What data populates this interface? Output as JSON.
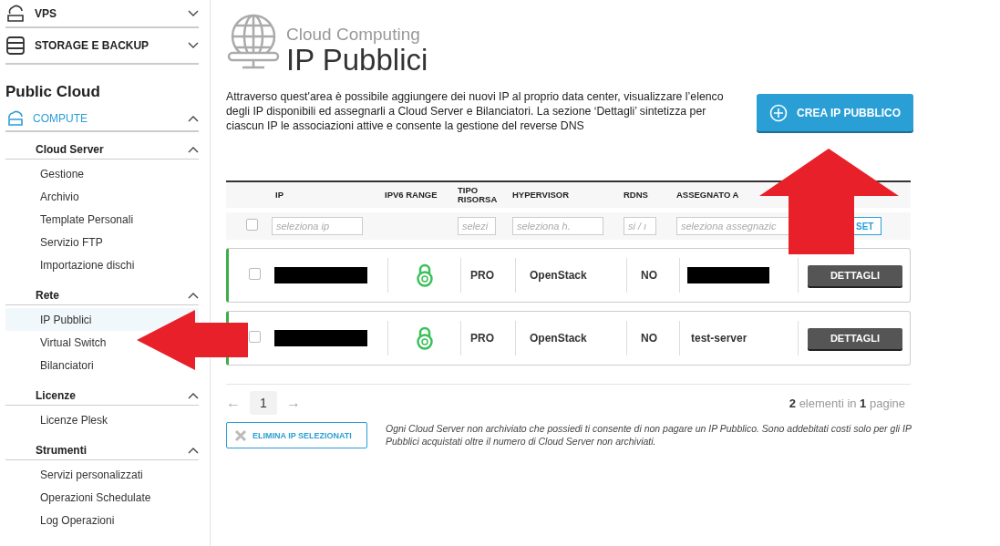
{
  "sidebar": {
    "products": [
      {
        "label": "VPS",
        "expanded": false,
        "kind": "cloud"
      },
      {
        "label": "STORAGE E BACKUP",
        "expanded": false,
        "kind": "storage"
      }
    ],
    "heading": "Public Cloud",
    "category": {
      "label": "COMPUTE",
      "expanded": true,
      "groups": [
        {
          "label": "Cloud Server",
          "expanded": true,
          "items": [
            {
              "label": "Gestione",
              "selected": false
            },
            {
              "label": "Archivio",
              "selected": false
            },
            {
              "label": "Template Personali",
              "selected": false
            },
            {
              "label": "Servizio FTP",
              "selected": false
            },
            {
              "label": "Importazione dischi",
              "selected": false
            }
          ]
        },
        {
          "label": "Rete",
          "expanded": true,
          "items": [
            {
              "label": "IP Pubblici",
              "selected": true
            },
            {
              "label": "Virtual Switch",
              "selected": false
            },
            {
              "label": "Bilanciatori",
              "selected": false
            }
          ]
        },
        {
          "label": "Licenze",
          "expanded": true,
          "items": [
            {
              "label": "Licenze Plesk",
              "selected": false
            }
          ]
        },
        {
          "label": "Strumenti",
          "expanded": true,
          "items": [
            {
              "label": "Servizi personalizzati",
              "selected": false
            },
            {
              "label": "Operazioni Schedulate",
              "selected": false
            },
            {
              "label": "Log Operazioni",
              "selected": false
            }
          ]
        }
      ]
    }
  },
  "header": {
    "subtitle": "Cloud Computing",
    "title": "IP Pubblici"
  },
  "description": "Attraverso quest'area è possibile aggiungere dei nuovi IP al proprio data center, visualizzare l’elenco degli IP disponibili ed assegnarli a Cloud Server e Bilanciatori. La sezione ‘Dettagli’ sintetizza per ciascun IP le associazioni attive e consente la gestione del reverse DNS",
  "create_button": "CREA IP PUBBLICO",
  "table": {
    "columns": [
      "IP",
      "IPV6 RANGE",
      "TIPO RISORSA",
      "HYPERVISOR",
      "RDNS",
      "ASSEGNATO A"
    ],
    "filters": {
      "checked": false,
      "ip": {
        "placeholder": "seleziona ip"
      },
      "tipo": {
        "placeholder": "selezi"
      },
      "hypervisor": {
        "placeholder": "seleziona h."
      },
      "rdns": {
        "placeholder": "si / ı"
      },
      "assigned": {
        "placeholder": "seleziona assegnazic"
      },
      "reset": "SET"
    },
    "rows": [
      {
        "checked": false,
        "active": true,
        "ip_redacted": true,
        "tipo": "PRO",
        "hypervisor": "OpenStack",
        "rdns": "NO",
        "assigned_redacted": true,
        "action": "DETTAGLI"
      },
      {
        "checked": false,
        "active": true,
        "ip_redacted": true,
        "tipo": "PRO",
        "hypervisor": "OpenStack",
        "rdns": "NO",
        "assigned_redacted": false,
        "assigned": "test-server",
        "action": "DETTAGLI"
      }
    ]
  },
  "pagination": {
    "prev": "←",
    "next": "→",
    "pages": [
      {
        "label": "1",
        "selected": true
      }
    ],
    "summary": "**2** elementi in **1** pagine"
  },
  "delete_button": "ELIMINA IP SELEZIONATI",
  "note": "Ogni Cloud Server non archiviato che possiedi ti consente di non pagare un IP Pubblico. Sono addebitati costi solo per gli IP Pubblici acquistati oltre il numero di Cloud Server non archiviati."
}
